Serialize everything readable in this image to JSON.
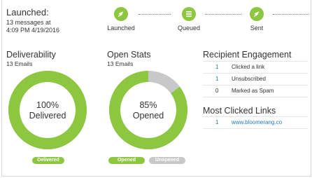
{
  "header": {
    "launched_title": "Launched:",
    "launched_sub1": "13 messages at",
    "launched_sub2": "4:09 PM 4/19/2016",
    "steps": [
      {
        "label": "Launched",
        "icon": "rocket-icon"
      },
      {
        "label": "Queued",
        "icon": "list-icon"
      },
      {
        "label": "Sent",
        "icon": "rocket-icon"
      }
    ]
  },
  "deliverability": {
    "title": "Deliverability",
    "subtitle": "13 Emails",
    "percent_text": "100%",
    "center_label": "Delivered",
    "fraction": 1.0,
    "pill": "Delivered"
  },
  "open_stats": {
    "title": "Open Stats",
    "subtitle": "13 Emails",
    "percent_text": "85%",
    "center_label": "Opened",
    "fraction": 0.85,
    "pill_opened": "Opened",
    "pill_unopened": "Unopened"
  },
  "engagement": {
    "title": "Recipient Engagement",
    "rows": [
      {
        "count": "1",
        "label": "Clicked a link"
      },
      {
        "count": "1",
        "label": "Unsubscribed"
      },
      {
        "count": "0",
        "label": "Marked as Spam"
      }
    ]
  },
  "most_clicked": {
    "title": "Most Clicked Links",
    "rows": [
      {
        "count": "1",
        "link": "www.bloomerang.co"
      }
    ]
  },
  "colors": {
    "green": "#8dc63f",
    "gray": "#c8c8c8",
    "link": "#1e78c2"
  }
}
